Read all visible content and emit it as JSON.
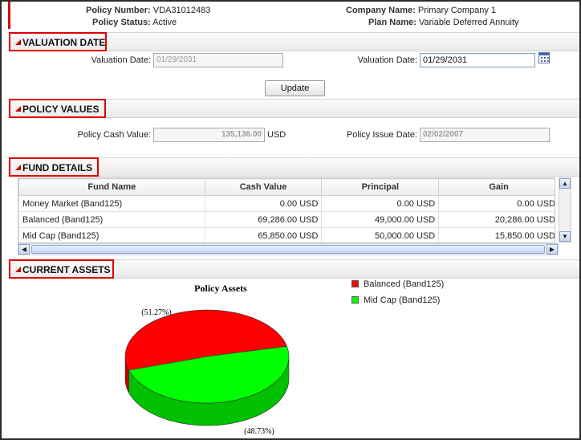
{
  "header": {
    "policy_number_label": "Policy Number:",
    "policy_number": "VDA31012483",
    "policy_status_label": "Policy Status:",
    "policy_status": "Active",
    "company_name_label": "Company Name:",
    "company_name": "Primary Company 1",
    "plan_name_label": "Plan Name:",
    "plan_name": "Variable Deferred Annuity"
  },
  "valuation": {
    "title": "VALUATION DATE",
    "left_label": "Valuation Date:",
    "left_value": "01/29/2031",
    "right_label": "Valuation Date:",
    "right_value": "01/29/2031",
    "update_label": "Update"
  },
  "policy_values": {
    "title": "POLICY VALUES",
    "cash_label": "Policy Cash Value:",
    "cash_value": "135,136.00",
    "cash_unit": "USD",
    "issue_label": "Policy Issue Date:",
    "issue_value": "02/02/2007"
  },
  "fund_details": {
    "title": "FUND DETAILS",
    "columns": [
      "Fund Name",
      "Cash Value",
      "Principal",
      "Gain"
    ],
    "rows": [
      [
        "Money Market (Band125)",
        "0.00 USD",
        "0.00 USD",
        "0.00 USD"
      ],
      [
        "Balanced (Band125)",
        "69,286.00 USD",
        "49,000.00 USD",
        "20,286.00 USD"
      ],
      [
        "Mid Cap (Band125)",
        "65,850.00 USD",
        "50,000.00 USD",
        "15,850.00 USD"
      ]
    ]
  },
  "current_assets": {
    "title": "CURRENT ASSETS"
  },
  "chart_data": {
    "type": "pie",
    "title": "Policy Assets",
    "labels": [
      "Balanced (Band125)",
      "Mid Cap (Band125)"
    ],
    "values": [
      51.27,
      48.73
    ],
    "value_labels": [
      "(51.27%)",
      "(48.73%)"
    ],
    "colors": [
      "#ff0000",
      "#00ff00"
    ],
    "legend_position": "top-right",
    "style": "3d"
  }
}
